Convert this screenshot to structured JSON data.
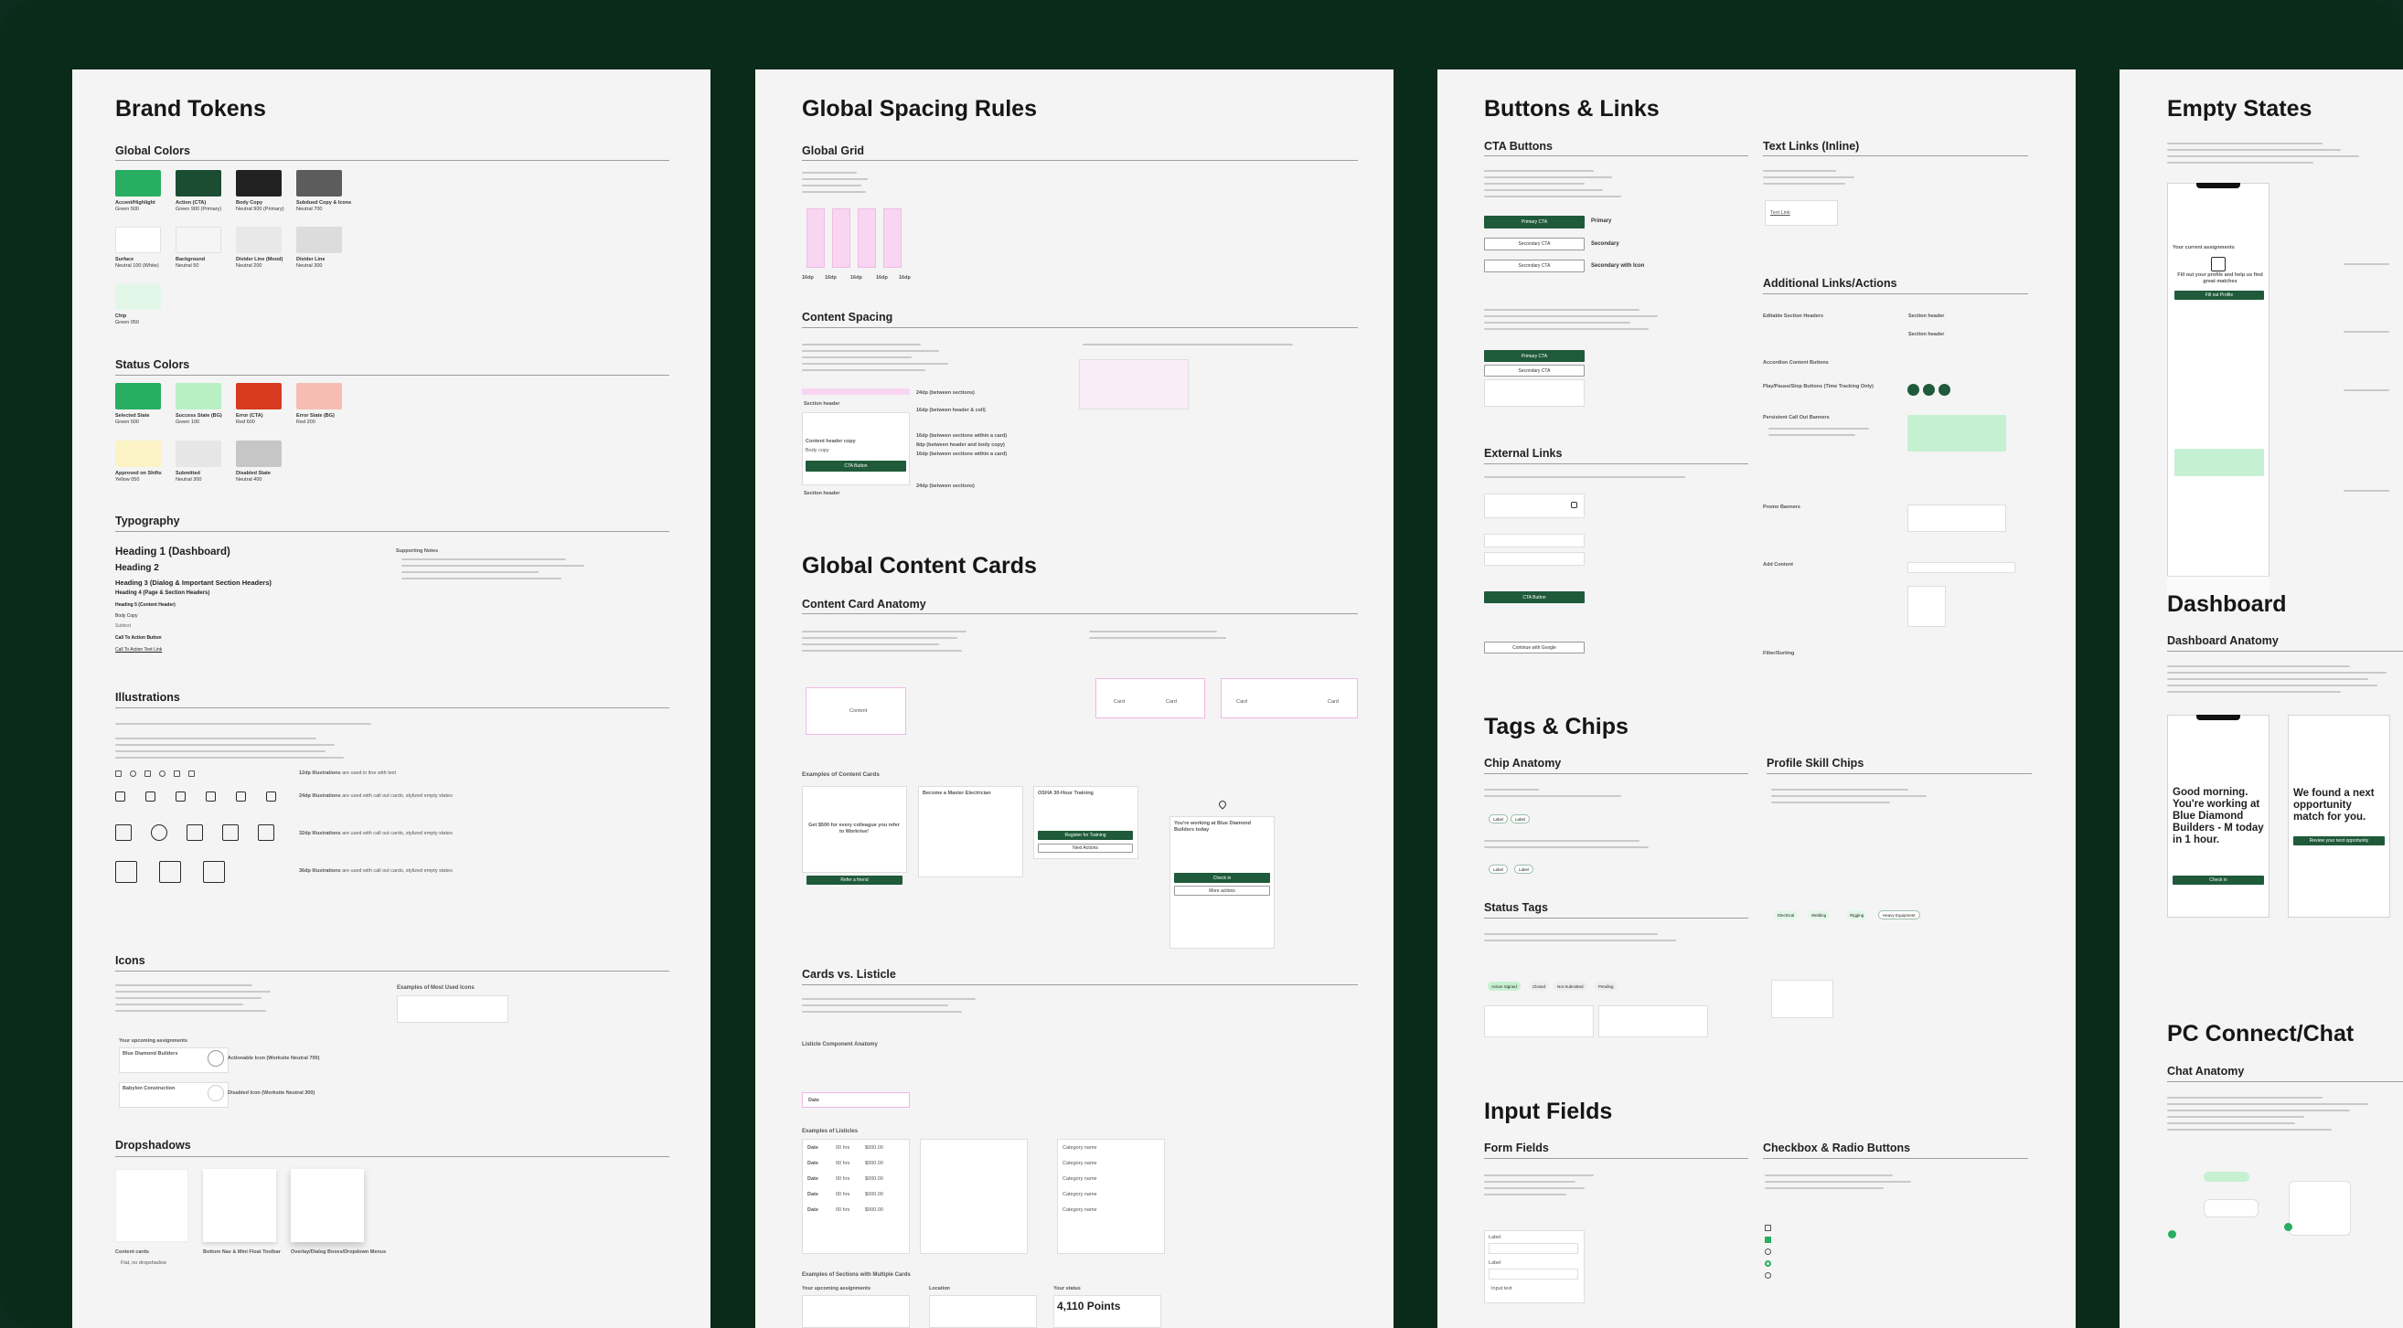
{
  "colors": {
    "accent": "#27ae60",
    "action": "#1b4d33",
    "body": "#222222",
    "subdued": "#5c5c5c",
    "surface": "#ffffff",
    "background": "#f5f5f5",
    "divider_mood": "#e8e8e8",
    "stroke": "#dcdcdc",
    "chip": "#e3f7e9",
    "success": "#b8f0c4",
    "error": "#d83a1f",
    "error_state": "#f7bdb4",
    "approved": "#fbf3c4",
    "submitted": "#e6e6e6",
    "disabled": "#c6c6c6",
    "frame": "#0a2a1a"
  },
  "brand_tokens": {
    "title": "Brand Tokens",
    "global_colors_title": "Global Colors",
    "global_colors": [
      {
        "name": "Accent/Highlight",
        "value": "Green 500"
      },
      {
        "name": "Action (CTA)",
        "value": "Green 900 (Primary)"
      },
      {
        "name": "Body Copy",
        "value": "Neutral 900 (Primary)"
      },
      {
        "name": "Subdued Copy & Icons",
        "value": "Neutral 700"
      },
      {
        "name": "Surface",
        "value": "Neutral 100 (White)"
      },
      {
        "name": "Background",
        "value": "Neutral 50"
      },
      {
        "name": "Divider Line (Mood)",
        "value": "Neutral 200"
      },
      {
        "name": "Divider Line",
        "value": "Neutral 300"
      },
      {
        "name": "Chip",
        "value": "Green 050"
      }
    ],
    "status_colors_title": "Status Colors",
    "status_colors": [
      {
        "name": "Selected State",
        "value": "Green 500"
      },
      {
        "name": "Success State (BG)",
        "value": "Green 100"
      },
      {
        "name": "Error (CTA)",
        "value": "Red 600"
      },
      {
        "name": "Error State (BG)",
        "value": "Red 200"
      },
      {
        "name": "Approved on Shifts",
        "value": "Yellow 050"
      },
      {
        "name": "Submitted",
        "value": "Neutral 300"
      },
      {
        "name": "Disabled State",
        "value": "Neutral 400"
      }
    ],
    "typography_title": "Typography",
    "typography": [
      "Heading 1 (Dashboard)",
      "Heading 2",
      "Heading 3 (Dialog & Important Section Headers)",
      "Heading 4 (Page & Section Headers)",
      "Heading 5 (Content Header)",
      "Body Copy",
      "Subtext",
      "Call To Action Button",
      "Call To Action Text Link"
    ],
    "supporting_notes_title": "Supporting Notes",
    "illustrations_title": "Illustrations",
    "illustration_sizes": [
      {
        "size": "12dp Illustrations",
        "note": "are used in line with text"
      },
      {
        "size": "24dp Illustrations",
        "note": "are used with call out cards, stylized empty states"
      },
      {
        "size": "32dp Illustrations",
        "note": "are used with call out cards, stylized empty states"
      },
      {
        "size": "36dp Illustrations",
        "note": "are used with call out cards, stylized empty states"
      }
    ],
    "icons_title": "Icons",
    "icons_examples_title": "Examples of Most Used Icons",
    "upcoming_assignments": "Your upcoming assignments",
    "assignment_1": "Blue Diamond Builders",
    "assignment_2": "Babylon Construction",
    "actionable_icon": "Actionable Icon (Worksite Neutral 700)",
    "disabled_icon": "Disabled Icon (Worksite Neutral 300)",
    "dropshadows_title": "Dropshadows",
    "dropshadows": [
      {
        "name": "Content cards",
        "note": "Flat, no dropshadow"
      },
      {
        "name": "Bottom Nav & Mini Float Toolbar"
      },
      {
        "name": "Overlay/Dialog Boxes/Dropdown Menus"
      }
    ]
  },
  "spacing": {
    "title": "Global Spacing Rules",
    "grid_title": "Global Grid",
    "grid_labels": [
      "16dp",
      "16dp",
      "16dp",
      "16dp",
      "16dp"
    ],
    "content_spacing_title": "Content Spacing",
    "section_header": "Section header",
    "content_header_copy": "Content header copy",
    "body_copy": "Body copy",
    "cta_button": "CTA Button",
    "spacing_notes": [
      "24dp (between sections)",
      "16dp (between header & cell)",
      "16dp (between sections within a card)",
      "8dp (between header and body copy)",
      "16dp (between sections within a card)",
      "24dp (between sections)"
    ]
  },
  "cards": {
    "title": "Global Content Cards",
    "anatomy_title": "Content Card Anatomy",
    "content_label": "Content",
    "card_label": "Card",
    "examples_title": "Examples of Content Cards",
    "referral_title": "Get $500 for every colleague you refer to Workrise!",
    "referral_button": "Refer a friend",
    "become_title": "Become a Master Electrician",
    "osha_title": "OSHA 30-Hour Training",
    "osha_button": "Register for Training",
    "osha_more": "Next Actions",
    "working_title": "You're working at Blue Diamond Builders today",
    "check_in": "Check in",
    "more_actions": "More actions",
    "listicle_title": "Cards vs. Listicle",
    "listicle_anatomy": "Listicle Component Anatomy",
    "listicle_examples": "Examples of Listicles",
    "multi_title": "Examples of Sections with Multiple Cards",
    "your_assignments": "Your upcoming assignments",
    "location_title": "Location",
    "status_title": "Your status",
    "points": "4,110 Points",
    "list_rows": [
      {
        "date": "Date",
        "a": "00 hrs",
        "b": "$000.00"
      },
      {
        "date": "Date",
        "a": "00 hrs",
        "b": "$000.00"
      },
      {
        "date": "Date",
        "a": "00 hrs",
        "b": "$000.00"
      },
      {
        "date": "Date",
        "a": "00 hrs",
        "b": "$000.00"
      },
      {
        "date": "Date",
        "a": "00 hrs",
        "b": "$000.00"
      }
    ],
    "categories": [
      "Category name",
      "Category name",
      "Category name",
      "Category name",
      "Category name"
    ]
  },
  "buttons": {
    "title": "Buttons & Links",
    "cta_title": "CTA Buttons",
    "primary_cta": "Primary CTA",
    "secondary_cta": "Secondary CTA",
    "primary": "Primary",
    "secondary": "Secondary",
    "secondary_icon": "Secondary with Icon",
    "text_links_title": "Text Links (Inline)",
    "text_link": "Text Link",
    "additional_title": "Additional Links/Actions",
    "editable_headers": "Editable Section Headers",
    "section_header": "Section header",
    "accordion": "Accordion Content Buttons",
    "play_pause": "Play/Pause/Stop Buttons (Time Tracking Only)",
    "persistent": "Persistent Call Out Banners",
    "promo": "Promo Banners",
    "add_content": "Add Content",
    "filter": "Filter/Sorting",
    "external_title": "External Links",
    "cta_external": "CTA Button",
    "continue_google": "Continue with Google"
  },
  "tags": {
    "title": "Tags & Chips",
    "chip_anatomy": "Chip Anatomy",
    "profile_chips": "Profile Skill Chips",
    "label": "Label",
    "status_tags": "Status Tags",
    "status_values": [
      "Action Signed",
      "Closed",
      "Not Submitted",
      "Pending"
    ],
    "skills": [
      "Electrical",
      "Welding",
      "Rigging",
      "Heavy Equipment"
    ]
  },
  "inputs": {
    "title": "Input Fields",
    "form_fields": "Form Fields",
    "checkbox_radio": "Checkbox & Radio Buttons",
    "label": "Label",
    "input_text": "Input text"
  },
  "empty": {
    "title": "Empty States",
    "fill_out": "Fill out your profile and help us find great matches",
    "dashboard_title": "Dashboard",
    "dashboard_anatomy": "Dashboard Anatomy",
    "good_morning": "Good morning. You're working at Blue Diamond Builders - M today in 1 hour.",
    "found_match": "We found a next opportunity match for you.",
    "pc_title": "PC Connect/Chat",
    "chat_anatomy": "Chat Anatomy"
  }
}
